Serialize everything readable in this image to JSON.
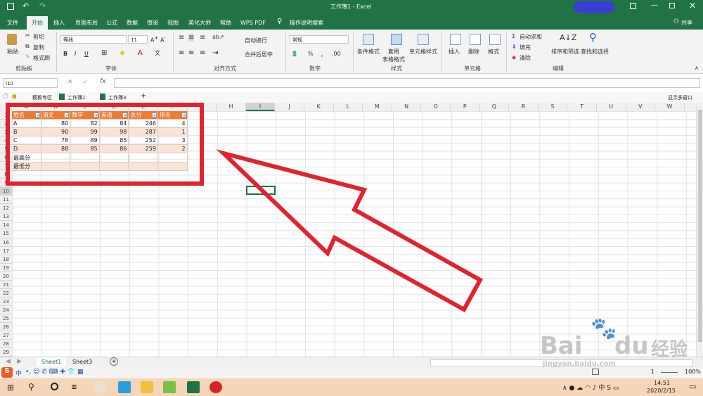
{
  "titlebar": {
    "title": "工作簿1  -  Excel",
    "share": "共享"
  },
  "tabs": [
    "文件",
    "开始",
    "插入",
    "页面布局",
    "公式",
    "数据",
    "审阅",
    "视图",
    "美化大师",
    "帮助",
    "WPS PDF",
    "操作说明搜索"
  ],
  "ribbon": {
    "clipboard": {
      "paste": "粘贴",
      "cut": "剪切",
      "copy": "复制",
      "painter": "格式刷",
      "group": "剪贴板"
    },
    "font": {
      "name": "等线",
      "size": "11",
      "group": "字体",
      "bold": "B",
      "italic": "I",
      "underline": "U"
    },
    "align": {
      "wrap": "自动换行",
      "merge": "合并后居中",
      "group": "对齐方式"
    },
    "number": {
      "format": "常规",
      "percent": "%",
      "comma": "，",
      "group": "数字"
    },
    "styles": {
      "cond": "条件格式",
      "table": "套用\n表格格式",
      "cell": "单元格样式",
      "group": "样式"
    },
    "cells": {
      "insert": "插入",
      "delete": "删除",
      "format": "格式",
      "group": "单元格"
    },
    "edit": {
      "autosum": "自动求和",
      "fill": "填充",
      "clear": "清除",
      "sort": "排序和筛选",
      "find": "查找和选择",
      "group": "编辑"
    }
  },
  "formulabar": {
    "namebox": "I10",
    "fx": "fx",
    "value": ""
  },
  "booktabs": [
    "模板专区",
    "工作簿1",
    "工作簿3"
  ],
  "booktabs_right": "显示多窗口",
  "columns": [
    "A",
    "B",
    "C",
    "D",
    "E",
    "F",
    "G",
    "H",
    "I",
    "J",
    "K",
    "L",
    "M",
    "N",
    "O",
    "P",
    "Q",
    "R",
    "S",
    "T",
    "U",
    "V",
    "W"
  ],
  "rows": [
    "1",
    "2",
    "3",
    "4",
    "5",
    "6",
    "7",
    "8",
    "9",
    "10",
    "11",
    "12",
    "13",
    "14",
    "15",
    "16",
    "17",
    "18",
    "19",
    "20",
    "21",
    "22",
    "23",
    "24",
    "25",
    "26",
    "27",
    "28",
    "29"
  ],
  "table": {
    "headers": [
      "姓名",
      "语文",
      "数学",
      "英语",
      "总分",
      "排名"
    ],
    "rows": [
      [
        "A",
        "80",
        "82",
        "84",
        "246",
        "4"
      ],
      [
        "B",
        "90",
        "99",
        "98",
        "287",
        "1"
      ],
      [
        "C",
        "78",
        "89",
        "85",
        "252",
        "3"
      ],
      [
        "D",
        "88",
        "85",
        "86",
        "259",
        "2"
      ],
      [
        "最高分",
        "",
        "",
        "",
        "",
        ""
      ],
      [
        "最低分",
        "",
        "",
        "",
        "",
        ""
      ]
    ]
  },
  "sheets": [
    "Sheet1",
    "Sheet3"
  ],
  "status": {
    "zoom": "100%",
    "page": "1"
  },
  "taskbar": {
    "time": "14:51",
    "date": "2020/2/15",
    "ime": "中"
  },
  "colors": {
    "excel_green": "#217346",
    "header_orange": "#ed7d31",
    "band": "#fbe4d5",
    "annotation_red": "#e0242f"
  }
}
